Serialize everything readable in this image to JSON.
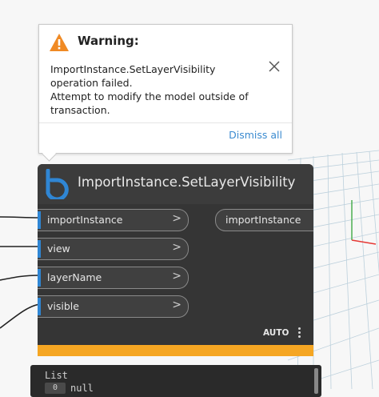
{
  "warning": {
    "title": "Warning:",
    "message": "ImportInstance.SetLayerVisibility\noperation failed.\nAttempt to modify the model outside of\ntransaction.",
    "dismiss_label": "Dismiss all"
  },
  "node": {
    "title": "ImportInstance.SetLayerVisibility",
    "inputs": [
      {
        "label": "importInstance",
        "chevron": ">"
      },
      {
        "label": "view",
        "chevron": ">"
      },
      {
        "label": "layerName",
        "chevron": ">"
      },
      {
        "label": "visible",
        "chevron": ">"
      }
    ],
    "output": {
      "label": "importInstance"
    },
    "lacing": "AUTO",
    "state_color": "#f5a623",
    "port_color": "#2f86d4"
  },
  "preview": {
    "title": "List",
    "index": "0",
    "value": "null"
  }
}
